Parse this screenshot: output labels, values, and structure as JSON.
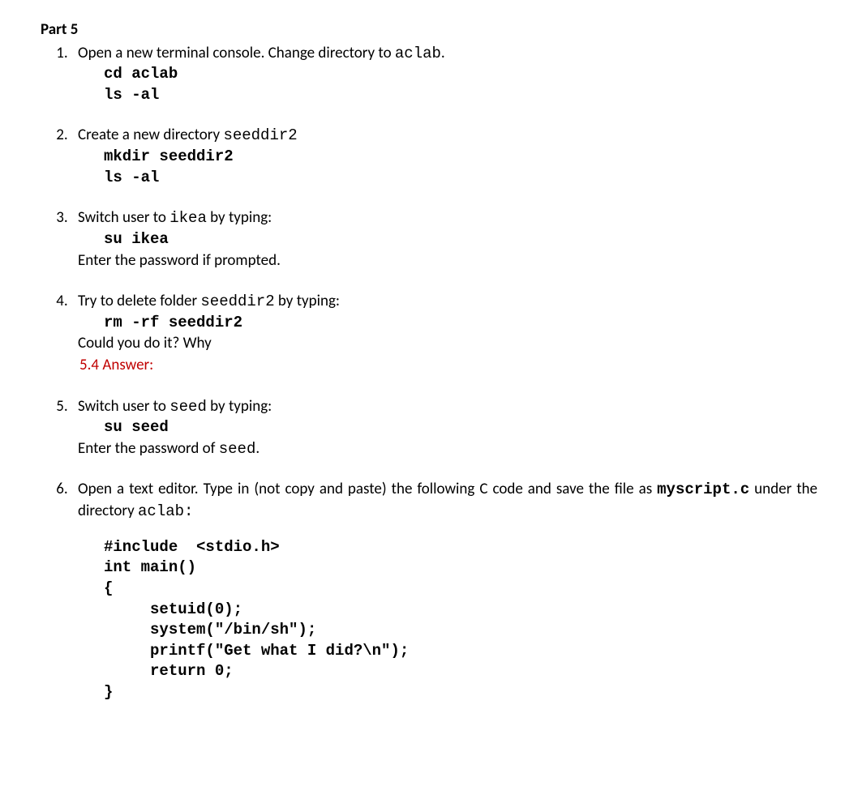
{
  "part_title": "Part 5",
  "items": [
    {
      "intro_pre": "Open a new terminal console. Change directory to ",
      "intro_mono": "aclab",
      "intro_post": ".",
      "cmds": "cd aclab\nls -al"
    },
    {
      "intro_pre": "Create a new directory ",
      "intro_mono": "seeddir2",
      "intro_post": "",
      "cmds": "mkdir seeddir2\nls -al"
    },
    {
      "intro_pre": "Switch user to ",
      "intro_mono": "ikea",
      "intro_post": "  by typing:",
      "cmds": "su ikea",
      "followup": "Enter the password if prompted."
    },
    {
      "intro_pre": "Try to delete folder ",
      "intro_mono": "seeddir2",
      "intro_post": " by typing:",
      "cmds": "rm -rf seeddir2",
      "followup": "Could you do it? Why",
      "answer_label": "5.4 Answer:"
    },
    {
      "intro_pre": "Switch user to ",
      "intro_mono": "seed",
      "intro_post": " by typing:",
      "cmds": "su seed",
      "followup_pre": "Enter the password of  ",
      "followup_mono": "seed",
      "followup_post": "."
    },
    {
      "line1_pre": "Open a text editor. Type in (not copy and paste) the following C code and save the file as ",
      "line2_mono1": "myscript.c",
      "line2_mid": " under the directory ",
      "line2_mono2": "aclab:",
      "code": "#include  <stdio.h>\nint main()\n{\n     setuid(0);\n     system(\"/bin/sh\");\n     printf(\"Get what I did?\\n\");\n     return 0;\n}"
    }
  ]
}
